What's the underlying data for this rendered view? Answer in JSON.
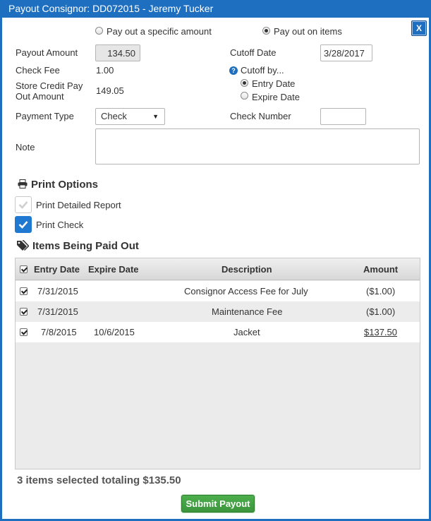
{
  "dialog": {
    "title": "Payout Consignor: DD072015 - Jeremy Tucker",
    "close_label": "X"
  },
  "payout_mode": {
    "specific_amount_label": "Pay out a specific amount",
    "on_items_label": "Pay out on items",
    "selected": "on_items"
  },
  "form": {
    "payout_amount_label": "Payout Amount",
    "payout_amount_value": "134.50",
    "check_fee_label": "Check Fee",
    "check_fee_value": "1.00",
    "store_credit_label_line1": "Store Credit Pay",
    "store_credit_label_line2": "Out Amount",
    "store_credit_value": "149.05",
    "cutoff_date_label": "Cutoff Date",
    "cutoff_date_value": "3/28/2017",
    "cutoff_by_label": "Cutoff by...",
    "cutoff_by_entry_label": "Entry Date",
    "cutoff_by_expire_label": "Expire Date",
    "cutoff_by_selected": "entry",
    "payment_type_label": "Payment Type",
    "payment_type_value": "Check",
    "check_number_label": "Check Number",
    "check_number_value": "",
    "note_label": "Note",
    "note_value": ""
  },
  "print_options": {
    "title": "Print Options",
    "detailed_report_label": "Print Detailed Report",
    "detailed_report_checked": false,
    "print_check_label": "Print Check",
    "print_check_checked": true
  },
  "items": {
    "title": "Items Being Paid Out",
    "columns": [
      "Entry Date",
      "Expire Date",
      "Description",
      "Amount"
    ],
    "rows": [
      {
        "entry_date": "7/31/2015",
        "expire_date": "",
        "description": "Consignor Access Fee for July",
        "amount": "($1.00)",
        "amount_is_link": false,
        "checked": true
      },
      {
        "entry_date": "7/31/2015",
        "expire_date": "",
        "description": "Maintenance Fee",
        "amount": "($1.00)",
        "amount_is_link": false,
        "checked": true
      },
      {
        "entry_date": "7/8/2015",
        "expire_date": "10/6/2015",
        "description": "Jacket",
        "amount": "$137.50",
        "amount_is_link": true,
        "checked": true
      }
    ]
  },
  "summary": "3 items selected totaling $135.50",
  "submit_label": "Submit Payout",
  "colors": {
    "titlebar": "#1f6fc0",
    "submit": "#45a345",
    "checked": "#1f79d1",
    "link": "#1a5bb4"
  }
}
